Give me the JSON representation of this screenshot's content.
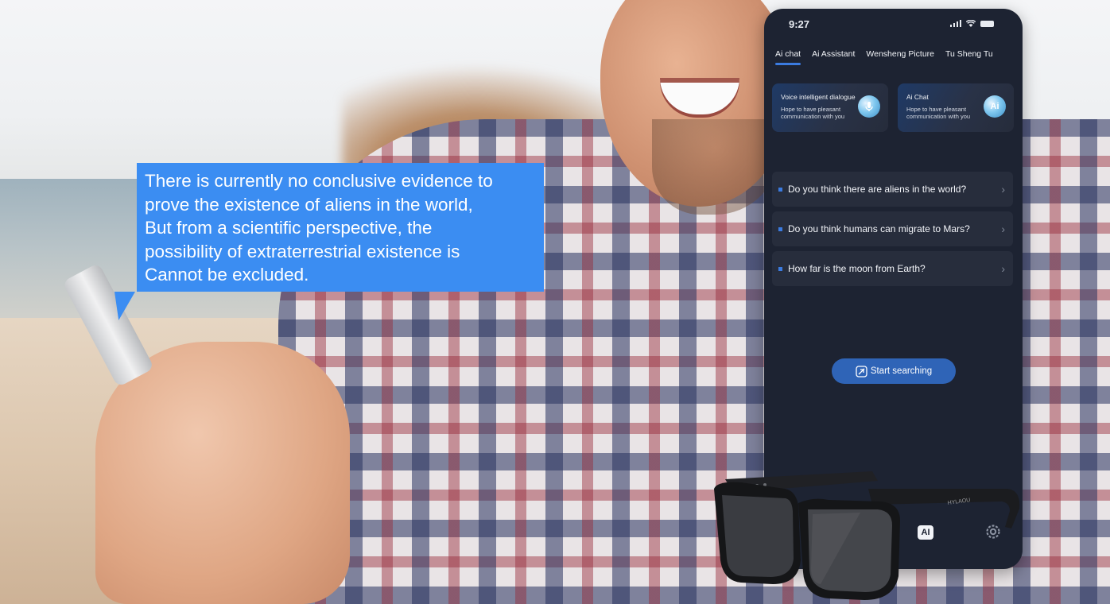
{
  "bubble": {
    "text": "There is currently no conclusive evidence to\nprove the existence of aliens in the world,\nBut from a scientific perspective, the\npossibility of extraterrestrial existence is\nCannot be excluded."
  },
  "app": {
    "status_time": "9:27",
    "tabs": [
      {
        "label": "Ai chat",
        "active": true
      },
      {
        "label": "Ai Assistant",
        "active": false
      },
      {
        "label": "Wensheng Picture",
        "active": false
      },
      {
        "label": "Tu Sheng Tu",
        "active": false
      }
    ],
    "cards": [
      {
        "title": "Voice intelligent dialogue",
        "subtitle": "Hope to have pleasant communication with you",
        "icon": "microphone-bubble-icon"
      },
      {
        "title": "Ai Chat",
        "subtitle": "Hope to have pleasant communication with you",
        "icon": "ai-bubble-icon",
        "icon_text": "Ai"
      }
    ],
    "questions": [
      {
        "text": "Do you think there are aliens in the world?"
      },
      {
        "text": "Do you think humans can migrate to Mars?"
      },
      {
        "text": "How far is the moon from Earth?"
      }
    ],
    "search_button": "Start searching",
    "bottom_nav": {
      "ai_label": "AI",
      "settings_icon": "gear-icon"
    }
  },
  "glasses": {
    "brand_text": "HYLAOU"
  },
  "colors": {
    "bubble": "#3b8df2",
    "app_bg": "#1d2332",
    "accent": "#3b7be0",
    "search_button": "#2f64b7"
  }
}
